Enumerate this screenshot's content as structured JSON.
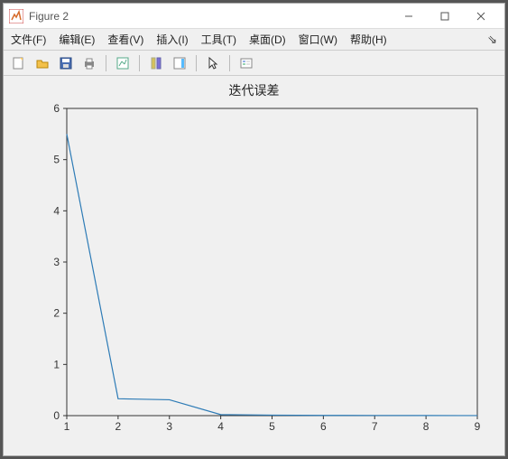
{
  "window": {
    "title": "Figure 2"
  },
  "menu": {
    "file": "文件(F)",
    "edit": "编辑(E)",
    "view": "查看(V)",
    "insert": "插入(I)",
    "tools": "工具(T)",
    "desktop": "桌面(D)",
    "window": "窗口(W)",
    "help": "帮助(H)"
  },
  "chart_data": {
    "type": "line",
    "title": "迭代误差",
    "xlabel": "",
    "ylabel": "",
    "xlim": [
      1,
      9
    ],
    "ylim": [
      0,
      6
    ],
    "xticks": [
      1,
      2,
      3,
      4,
      5,
      6,
      7,
      8,
      9
    ],
    "yticks": [
      0,
      1,
      2,
      3,
      4,
      5,
      6
    ],
    "x": [
      1,
      2,
      3,
      4,
      5,
      6,
      7,
      8,
      9
    ],
    "y": [
      5.5,
      0.33,
      0.31,
      0.02,
      0.01,
      0.005,
      0.003,
      0.002,
      0.001
    ]
  }
}
